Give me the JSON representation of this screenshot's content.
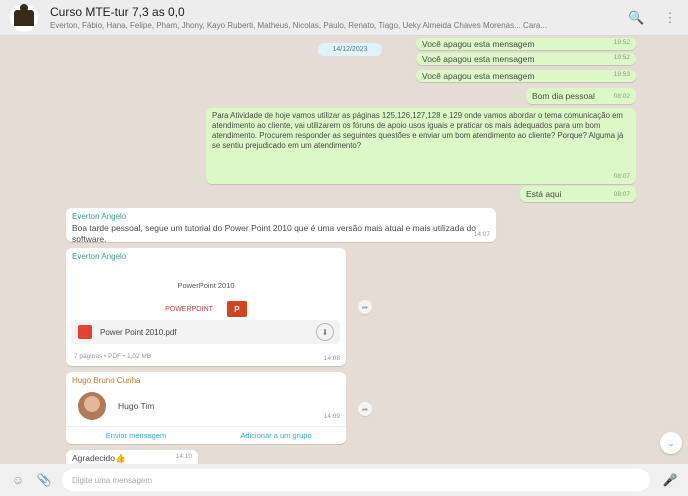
{
  "header": {
    "title": "Curso MTE-tur 7,3 as 0,0",
    "members": "Everton, Fábio, Hana, Felipe, Pham, Jhony, Kayo Ruberti, Matheus, Nicolas, Paulo, Renato, Tiago, Ueky Almeida Chaves Morenas... Cara..."
  },
  "date_badge": "14/12/2023",
  "messages": {
    "forwarded": [
      {
        "text": "Você apagou esta mensagem",
        "time": "19:52"
      },
      {
        "text": "Você apagou esta mensagem",
        "time": "19:52"
      },
      {
        "text": "Você apagou esta mensagem",
        "time": "19:53"
      }
    ],
    "bom_dia": {
      "text": "Bom dia pessoal",
      "time": "08:02"
    },
    "activity": {
      "text": "Para Atividade de hoje vamos utilizar as páginas 125,126,127,128 e 129 onde vamos abordar o tema comunicação em atendimento ao cliente, vai utilizarem os fóruns de apoio usos iguais e praticar os mais adequados para um bom atendimento. Procurem responder as seguintes questões e enviar um bom atendimento ao cliente? Porque? Alguma já se sentiu prejudicado em um atendimento?",
      "time": "08:07"
    },
    "esta_aqui": {
      "text": "Está aqui",
      "time": "08:07"
    },
    "incoming_1": {
      "sender": "Everton Angelo",
      "text": "Boa tarde pessoal, segue um tutorial do Power Point 2010 que é uma versão mais atual e mais utilizada do software.",
      "time": "14:07"
    },
    "document": {
      "sender": "Everton Angelo",
      "title": "PowerPoint 2010",
      "app_label": "POWERPOINT",
      "file_name": "Power Point 2010.pdf",
      "meta": "7 páginas • PDF • 1,02 MB",
      "time": "14:08"
    },
    "contact": {
      "sender": "Hugo Bruno Cunha",
      "name": "Hugo Tim",
      "time": "14:09",
      "action_left": "Enviar mensagem",
      "action_right": "Adicionar a um grupo"
    },
    "last": {
      "text": "Agradecido👍",
      "time": "14:10"
    }
  },
  "composer": {
    "placeholder": "Digite uma mensagem"
  },
  "icons": {
    "search": "🔍",
    "menu": "⋮",
    "emoji": "☺",
    "attach": "📎",
    "mic": "🎤",
    "forward": "➦",
    "download": "⬇",
    "scroll": "⌄"
  }
}
